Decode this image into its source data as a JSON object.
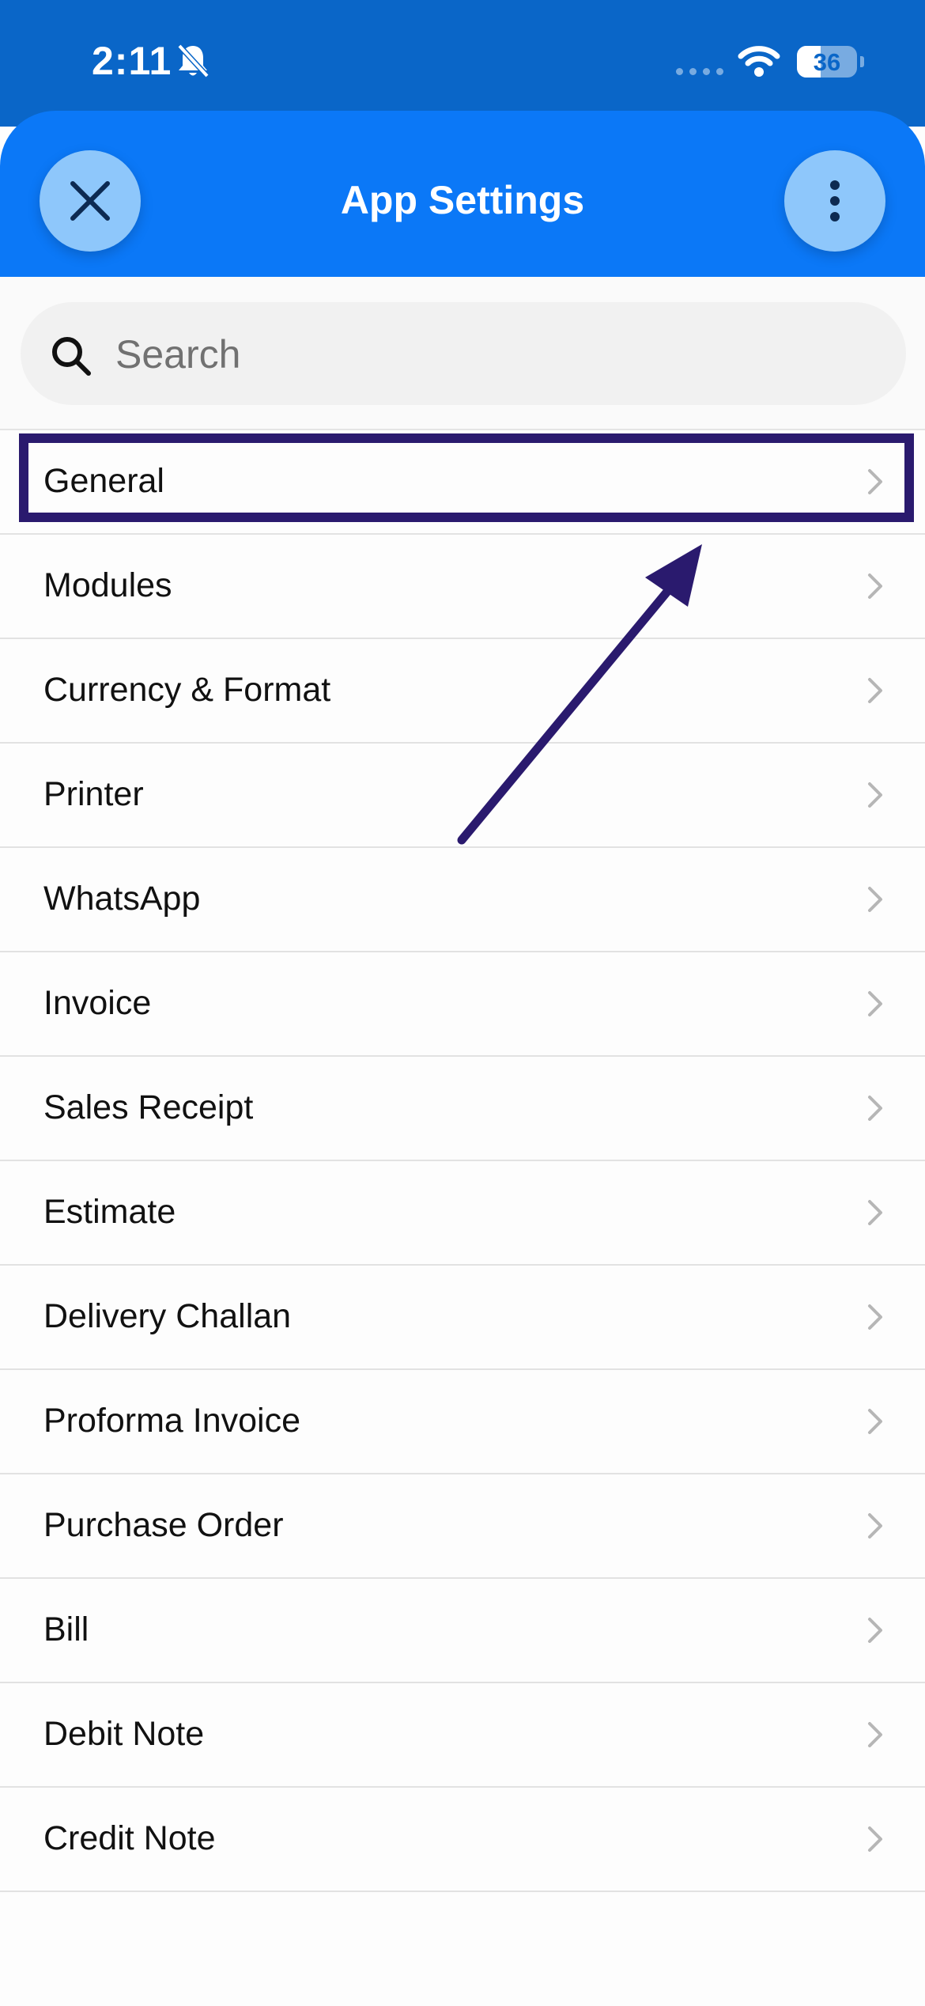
{
  "status_bar": {
    "time": "2:11",
    "battery_level": "36",
    "icons": [
      "bell-slash-icon",
      "signal-icon",
      "wifi-icon",
      "battery-icon"
    ]
  },
  "header": {
    "title": "App Settings",
    "close_icon": "close-icon",
    "more_icon": "more-vertical-icon"
  },
  "search": {
    "placeholder": "Search",
    "value": "",
    "icon": "search-icon"
  },
  "colors": {
    "header": "#0b78f7",
    "status_bar": "#0a66c8",
    "round_button": "#8ec7fb",
    "annotation": "#2a1a6e"
  },
  "settings": {
    "items": [
      {
        "label": "General"
      },
      {
        "label": "Modules"
      },
      {
        "label": "Currency & Format"
      },
      {
        "label": "Printer"
      },
      {
        "label": "WhatsApp"
      },
      {
        "label": "Invoice"
      },
      {
        "label": "Sales Receipt"
      },
      {
        "label": "Estimate"
      },
      {
        "label": "Delivery Challan"
      },
      {
        "label": "Proforma Invoice"
      },
      {
        "label": "Purchase Order"
      },
      {
        "label": "Bill"
      },
      {
        "label": "Debit Note"
      },
      {
        "label": "Credit Note"
      }
    ]
  },
  "annotation": {
    "highlighted_item": "General",
    "arrow_icon": "arrow-icon"
  }
}
